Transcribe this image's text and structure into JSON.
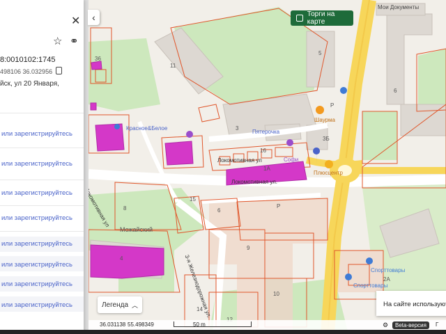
{
  "sidebar": {
    "close_icon": "close-icon",
    "cadastral_number_partial": "8:0010102:1745",
    "coordinates_partial": "498106 36.032956",
    "address_partial": "йск, ул 20 Января,",
    "action_icons": [
      "star-icon",
      "share-icon"
    ],
    "auth_links": [
      "или зарегистрируйтесь",
      "или зарегистрируйтесь",
      "или зарегистрируйтесь",
      "или зарегистрируйтесь",
      "или зарегистрируйтесь",
      "или зарегистрируйтесь",
      "или зарегистрируйтесь",
      "или зарегистрируйтесь"
    ]
  },
  "map": {
    "auctions_button_label": "Торги на карте",
    "legend_button_label": "Легенда",
    "cookie_notice_partial": "На сайте используютс",
    "coordinates_readout": {
      "lon": "36.031138",
      "lat": "55.498349"
    },
    "scale_label": "50 m",
    "beta_label": "Beta-версия",
    "edge_partial": "Г",
    "street_labels": [
      "Локомотивная ул",
      "Локомотивная ул.",
      "3-я Железнодорожная ул.",
      "Локомотивная ул"
    ],
    "poi_labels": [
      "Мои Документы",
      "Красное&Белое",
      "Шаурма",
      "Пятерочка",
      "Софи",
      "Плюсцентр",
      "Спорттовары",
      "Спорттовары"
    ],
    "area_labels": [
      "Можайский"
    ],
    "house_numbers": [
      "36",
      "11",
      "5",
      "6",
      "3",
      "3Б",
      "16",
      "1А",
      "8",
      "6",
      "9",
      "10",
      "14",
      "12",
      "15",
      "4",
      "2А",
      "Р",
      "Р"
    ],
    "colors": {
      "parcel_outline": "#e0562b",
      "selected_parcel": "#d438c8",
      "road_yellow": "#f7d65a",
      "building": "#e6d8c6",
      "park": "#cde8bd",
      "button_green": "#1e6b3a"
    }
  }
}
